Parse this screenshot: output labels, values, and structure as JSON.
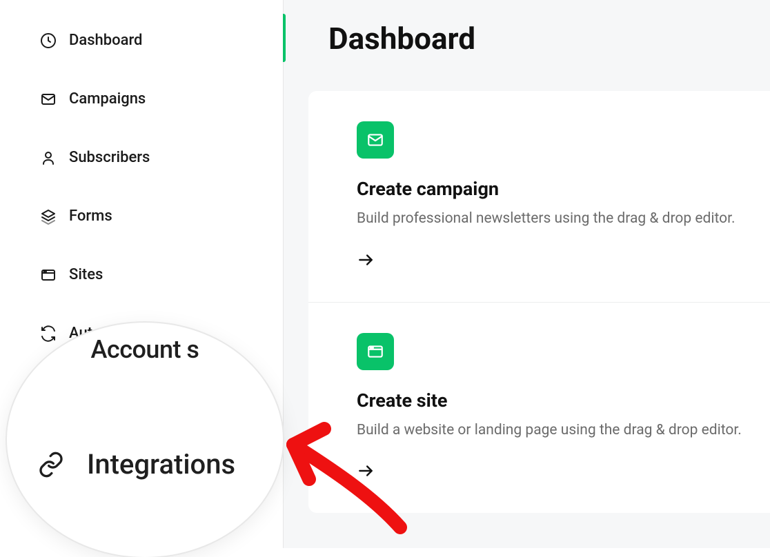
{
  "sidebar": {
    "items": [
      {
        "label": "Dashboard"
      },
      {
        "label": "Campaigns"
      },
      {
        "label": "Subscribers"
      },
      {
        "label": "Forms"
      },
      {
        "label": "Sites"
      },
      {
        "label": "Automation"
      }
    ]
  },
  "magnifier": {
    "account_label": "Account s",
    "integrations_label": "Integrations"
  },
  "main": {
    "title": "Dashboard",
    "cards": [
      {
        "title": "Create campaign",
        "desc": "Build professional newsletters using the drag & drop editor."
      },
      {
        "title": "Create site",
        "desc": "Build a website or landing page using the drag & drop editor."
      }
    ]
  },
  "colors": {
    "accent": "#09c269"
  }
}
